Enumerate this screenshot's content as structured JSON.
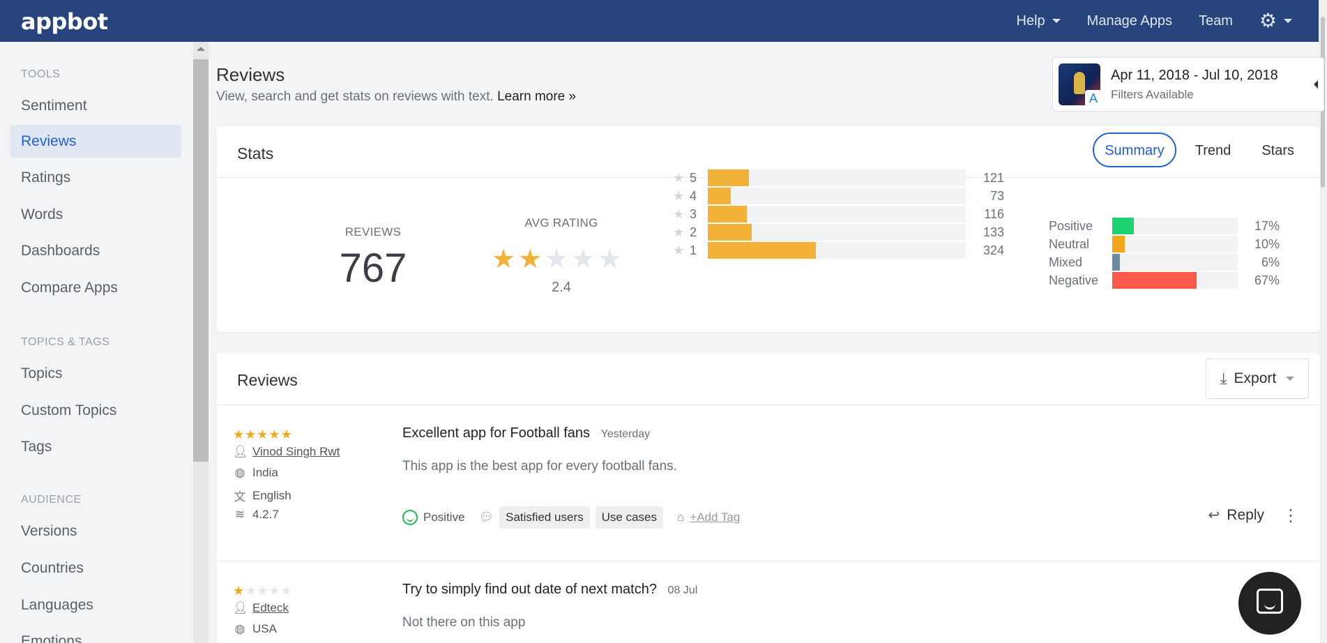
{
  "topbar": {
    "logo": "appbot",
    "nav": [
      {
        "label": "Help",
        "has_caret": true
      },
      {
        "label": "Manage Apps",
        "has_caret": false
      },
      {
        "label": "Team",
        "has_caret": false
      }
    ],
    "settings_icon": "gear-icon"
  },
  "sidebar": {
    "sections": [
      {
        "title": "TOOLS",
        "items": [
          "Sentiment",
          "Reviews",
          "Ratings",
          "Words",
          "Dashboards",
          "Compare Apps"
        ]
      },
      {
        "title": "TOPICS & TAGS",
        "items": [
          "Topics",
          "Custom Topics",
          "Tags"
        ]
      },
      {
        "title": "AUDIENCE",
        "items": [
          "Versions",
          "Countries",
          "Languages",
          "Emotions"
        ]
      }
    ],
    "active": "Reviews"
  },
  "header": {
    "title": "Reviews",
    "subtitle": "View, search and get stats on reviews with text.",
    "learn_more": "Learn more »"
  },
  "date_card": {
    "range": "Apr 11, 2018 - Jul 10, 2018",
    "filters": "Filters Available"
  },
  "stats": {
    "title": "Stats",
    "tabs": [
      "Summary",
      "Trend",
      "Stars"
    ],
    "active_tab": "Summary",
    "reviews_label": "REVIEWS",
    "reviews_count": "767",
    "avg_label": "AVG RATING",
    "avg_rating": "2.4",
    "avg_rating_value": 2.4,
    "distribution": [
      {
        "stars": "5",
        "count": "121",
        "fraction": 0.16
      },
      {
        "stars": "4",
        "count": "73",
        "fraction": 0.09
      },
      {
        "stars": "3",
        "count": "116",
        "fraction": 0.15
      },
      {
        "stars": "2",
        "count": "133",
        "fraction": 0.17
      },
      {
        "stars": "1",
        "count": "324",
        "fraction": 0.42
      }
    ],
    "sentiment": [
      {
        "label": "Positive",
        "pct": "17%",
        "fraction": 0.17,
        "color": "#1ed36f"
      },
      {
        "label": "Neutral",
        "pct": "10%",
        "fraction": 0.1,
        "color": "#f2a71b"
      },
      {
        "label": "Mixed",
        "pct": "6%",
        "fraction": 0.06,
        "color": "#6f8aa6"
      },
      {
        "label": "Negative",
        "pct": "67%",
        "fraction": 0.67,
        "color": "#fa5a4a"
      }
    ]
  },
  "reviews": {
    "title": "Reviews",
    "export_label": "Export",
    "items": [
      {
        "rating": 5,
        "author": "Vinod Singh Rwt",
        "country": "India",
        "language": "English",
        "version": "4.2.7",
        "title": "Excellent app for Football fans",
        "date": "Yesterday",
        "body": "This app is the best app for every football fans.",
        "sentiment": "Positive",
        "topics": [
          "Satisfied users",
          "Use cases"
        ],
        "add_tag": "+Add Tag",
        "reply": "Reply"
      },
      {
        "rating": 1,
        "author": "Edteck",
        "country": "USA",
        "title": "Try to simply find out date of next match?",
        "date": "08 Jul",
        "body": "Not there on this app"
      }
    ]
  },
  "colors": {
    "brand": "#27457c",
    "accent": "#1f5fd6",
    "star": "#f2b238"
  }
}
